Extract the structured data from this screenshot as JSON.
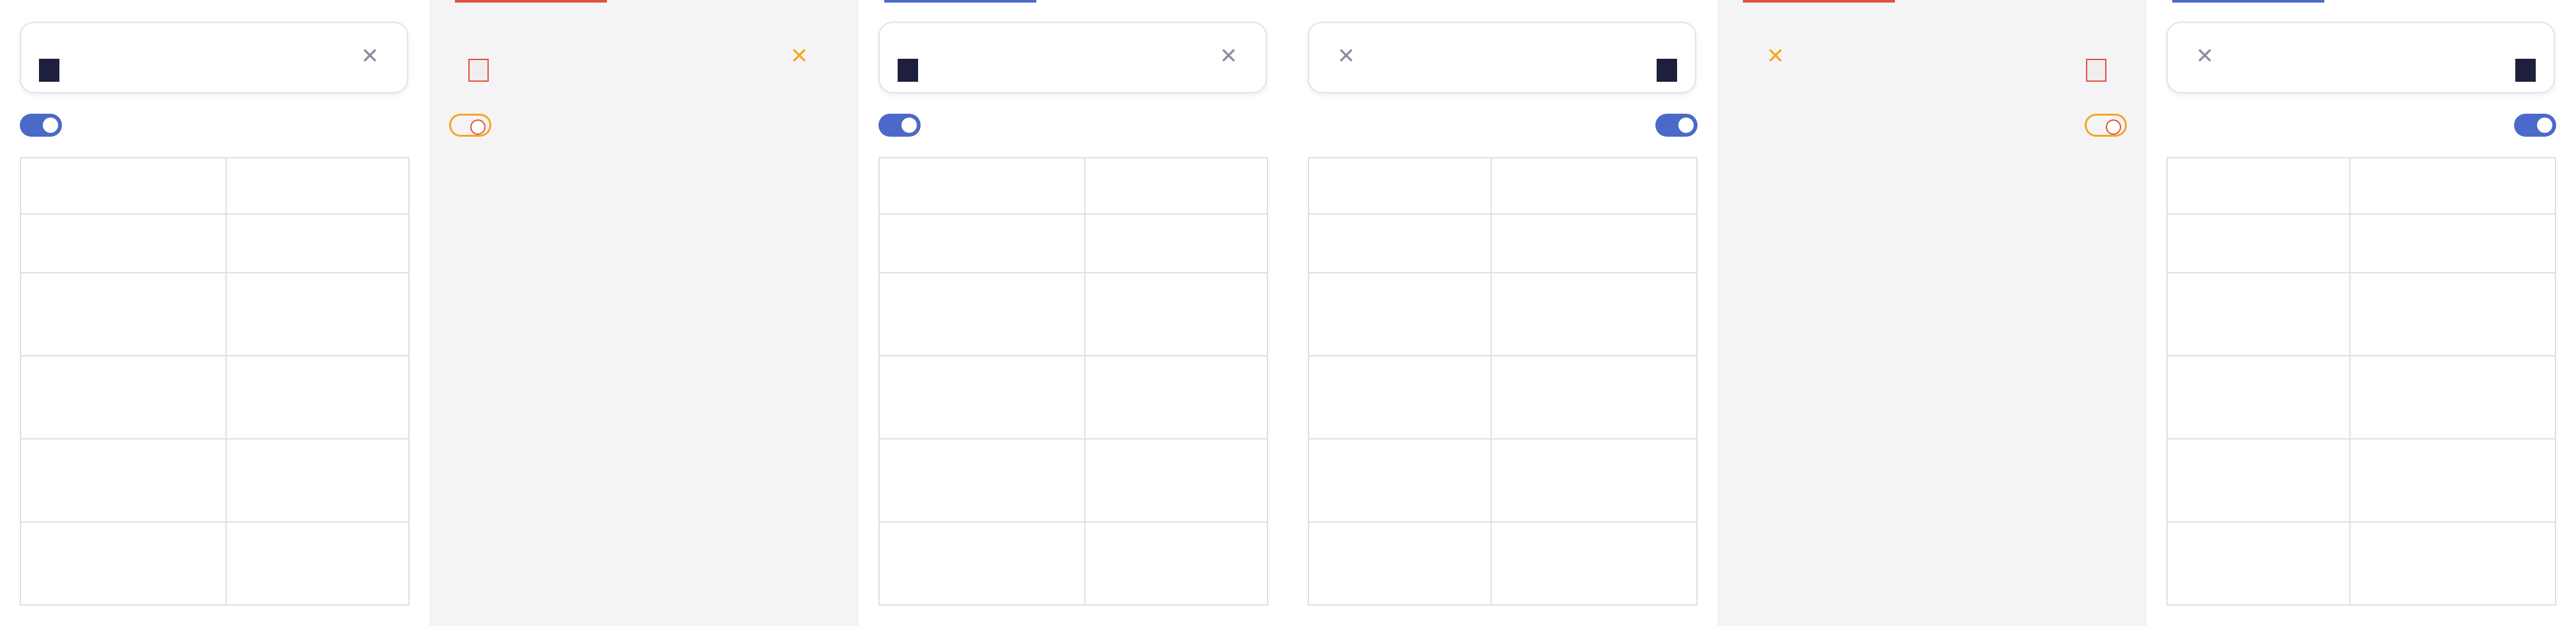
{
  "panels": [
    {
      "id": "p1",
      "variant": "white",
      "direction": "ltr",
      "topbar_color": "",
      "search": {
        "line1": "",
        "line2": ""
      },
      "toggle_label": "",
      "table": {
        "headers": [
          "",
          ""
        ],
        "rows": [
          [
            "",
            ""
          ],
          [
            "",
            ""
          ],
          [
            "",
            ""
          ],
          [
            "",
            ""
          ],
          [
            "",
            ""
          ]
        ]
      }
    },
    {
      "id": "p2",
      "variant": "grey",
      "direction": "ltr",
      "topbar_color": "#e0523a",
      "debug": true,
      "search": {
        "line1": "",
        "line2": ""
      },
      "toggle_label": "",
      "table": {
        "headers": [
          "",
          ""
        ],
        "rows": [
          [
            "",
            ""
          ],
          [
            "",
            ""
          ],
          [
            "",
            ""
          ],
          [
            "",
            ""
          ],
          [
            "",
            ""
          ]
        ]
      }
    },
    {
      "id": "p3",
      "variant": "white",
      "direction": "ltr",
      "topbar_color": "#4b69c8",
      "search": {
        "line1": "",
        "line2": ""
      },
      "toggle_label": "",
      "table": {
        "headers": [
          "",
          ""
        ],
        "rows": [
          [
            "",
            ""
          ],
          [
            "",
            ""
          ],
          [
            "",
            ""
          ],
          [
            "",
            ""
          ],
          [
            "",
            ""
          ]
        ]
      }
    },
    {
      "id": "p4",
      "variant": "white",
      "direction": "rtl",
      "topbar_color": "",
      "search": {
        "line1": "",
        "line2": ""
      },
      "toggle_label": "",
      "table": {
        "headers": [
          "",
          ""
        ],
        "rows": [
          [
            "",
            ""
          ],
          [
            "",
            ""
          ],
          [
            "",
            ""
          ],
          [
            "",
            ""
          ],
          [
            "",
            ""
          ]
        ]
      }
    },
    {
      "id": "p5",
      "variant": "grey",
      "direction": "rtl",
      "topbar_color": "#e0523a",
      "debug": true,
      "search": {
        "line1": "",
        "line2": ""
      },
      "toggle_label": "",
      "table": {
        "headers": [
          "",
          ""
        ],
        "rows": [
          [
            "",
            ""
          ],
          [
            "",
            ""
          ],
          [
            "",
            ""
          ],
          [
            "",
            ""
          ],
          [
            "",
            ""
          ]
        ]
      }
    },
    {
      "id": "p6",
      "variant": "white",
      "direction": "rtl",
      "topbar_color": "#4b69c8",
      "search": {
        "line1": "",
        "line2": ""
      },
      "toggle_label": "",
      "table": {
        "headers": [
          "",
          ""
        ],
        "rows": [
          [
            "",
            ""
          ],
          [
            "",
            ""
          ],
          [
            "",
            ""
          ],
          [
            "",
            ""
          ],
          [
            "",
            ""
          ]
        ]
      }
    }
  ],
  "icons": {
    "clear": "close-icon",
    "toggle": "toggle-switch"
  },
  "colors": {
    "accent": "#4b69c8",
    "text_dark": "#1e1f3d",
    "text_muted": "#707384",
    "border": "#dfe0e7",
    "debug_red": "#e0523a",
    "debug_orange": "#f5a623"
  }
}
